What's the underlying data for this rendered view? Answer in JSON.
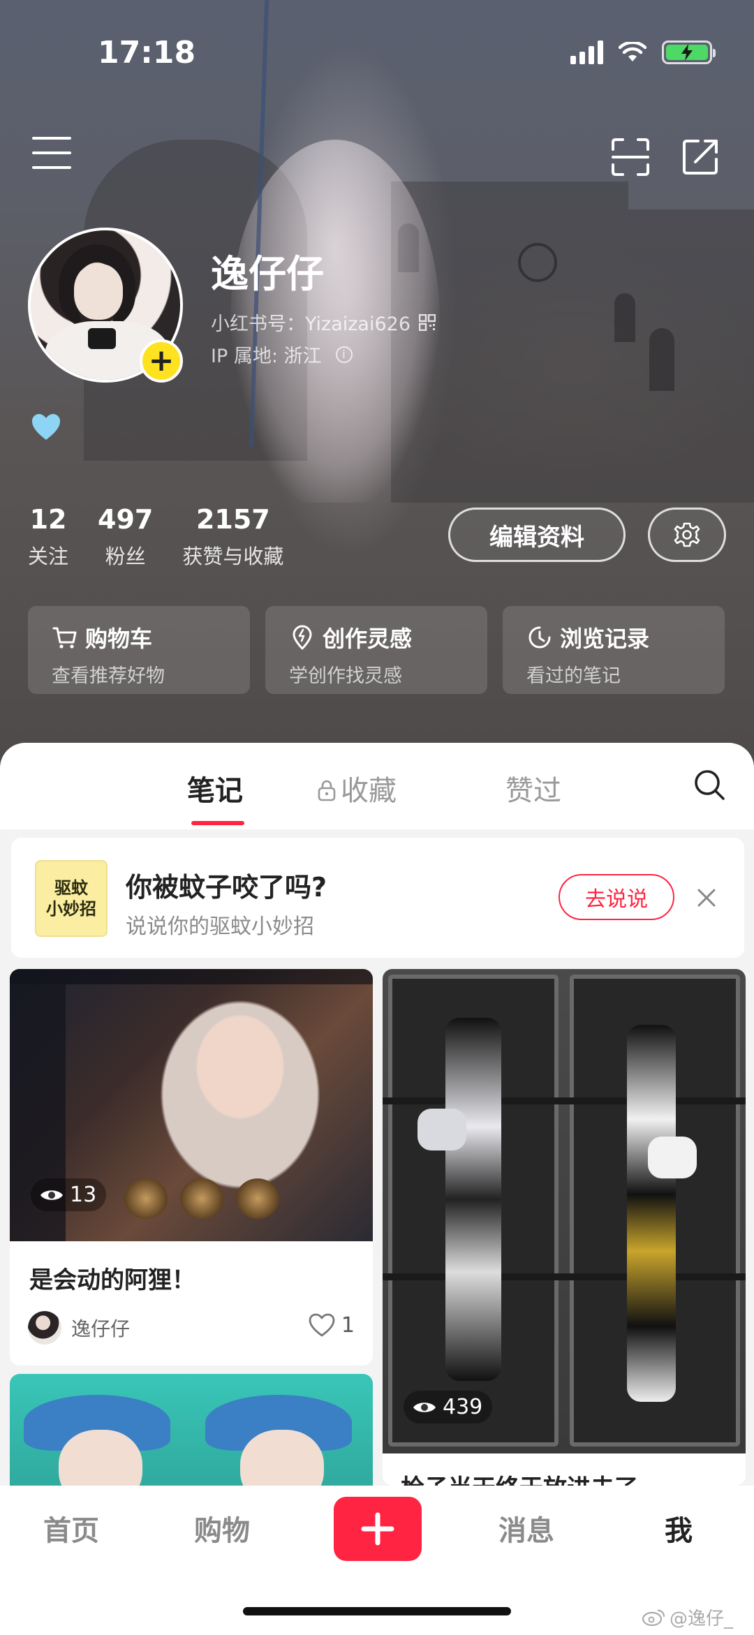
{
  "status_bar": {
    "time": "17:18"
  },
  "profile": {
    "username": "逸仔仔",
    "red_id_label": "小红书号：",
    "red_id": "Yizaizai626",
    "ip_label": "IP 属地: ",
    "ip_location": "浙江",
    "emoji": "light-blue-heart",
    "follow_badge": "+"
  },
  "stats": [
    {
      "value": "12",
      "label": "关注"
    },
    {
      "value": "497",
      "label": "粉丝"
    },
    {
      "value": "2157",
      "label": "获赞与收藏"
    }
  ],
  "buttons": {
    "edit_profile": "编辑资料"
  },
  "shortcuts": [
    {
      "title": "购物车",
      "subtitle": "查看推荐好物",
      "icon": "cart-icon"
    },
    {
      "title": "创作灵感",
      "subtitle": "学创作找灵感",
      "icon": "bulb-pin-icon"
    },
    {
      "title": "浏览记录",
      "subtitle": "看过的笔记",
      "icon": "clock-icon"
    }
  ],
  "tabs": [
    {
      "label": "笔记",
      "active": true
    },
    {
      "label": "收藏",
      "locked": true
    },
    {
      "label": "赞过"
    }
  ],
  "promo": {
    "thumb_line1": "驱蚊",
    "thumb_line2": "小妙招",
    "title": "你被蚊子咬了吗?",
    "subtitle": "说说你的驱蚊小妙招",
    "action": "去说说"
  },
  "notes": [
    {
      "views": "13",
      "title": "是会动的阿狸！",
      "author": "逸仔仔",
      "likes": "1"
    },
    {
      "views": "439",
      "title": "枪子当天终于放进去了"
    }
  ],
  "bottom_nav": {
    "home": "首页",
    "shop": "购物",
    "messages": "消息",
    "me": "我"
  },
  "watermark": "@逸仔_",
  "colors": {
    "accent": "#ff2442",
    "badge": "#ffe21f"
  }
}
